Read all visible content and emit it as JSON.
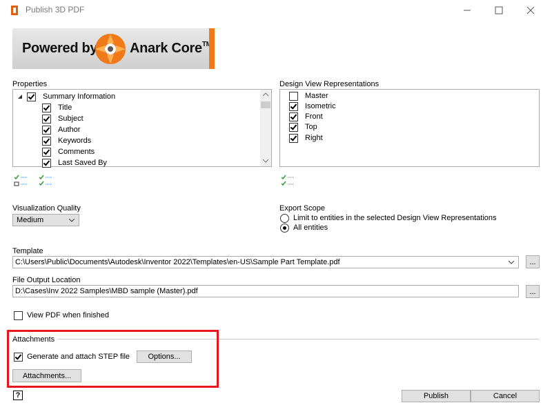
{
  "window": {
    "title": "Publish 3D PDF"
  },
  "banner": {
    "left_text": "Powered by",
    "right_text": "Anark Core",
    "trademark": "TM"
  },
  "properties": {
    "label": "Properties",
    "group": {
      "label": "Summary Information",
      "checked": true
    },
    "items": [
      {
        "label": "Title",
        "checked": true
      },
      {
        "label": "Subject",
        "checked": true
      },
      {
        "label": "Author",
        "checked": true
      },
      {
        "label": "Keywords",
        "checked": true
      },
      {
        "label": "Comments",
        "checked": true
      },
      {
        "label": "Last Saved By",
        "checked": true
      }
    ]
  },
  "design_views": {
    "label": "Design View Representations",
    "items": [
      {
        "label": "Master",
        "checked": false
      },
      {
        "label": "Isometric",
        "checked": true
      },
      {
        "label": "Front",
        "checked": true
      },
      {
        "label": "Top",
        "checked": true
      },
      {
        "label": "Right",
        "checked": true
      }
    ]
  },
  "visualization": {
    "label": "Visualization Quality",
    "value": "Medium"
  },
  "export_scope": {
    "label": "Export Scope",
    "options": [
      {
        "label": "Limit to entities in the selected Design View Representations",
        "selected": false
      },
      {
        "label": "All entities",
        "selected": true
      }
    ]
  },
  "template": {
    "label": "Template",
    "value": "C:\\Users\\Public\\Documents\\Autodesk\\Inventor 2022\\Templates\\en-US\\Sample Part Template.pdf",
    "browse": "..."
  },
  "output": {
    "label": "File Output Location",
    "value": "D:\\Cases\\Inv 2022 Samples\\MBD sample (Master).pdf",
    "browse": "..."
  },
  "view_pdf": {
    "label": "View PDF when finished",
    "checked": false
  },
  "attachments": {
    "label": "Attachments",
    "step_label": "Generate and attach STEP file",
    "step_checked": true,
    "options_button": "Options...",
    "attachments_button": "Attachments..."
  },
  "footer": {
    "help": "?",
    "publish": "Publish",
    "cancel": "Cancel"
  },
  "colors": {
    "accent_red": "#e8141e",
    "banner_orange": "#f07a1a",
    "check_green": "#2e9e2e",
    "check_blue": "#3a7fd5"
  }
}
